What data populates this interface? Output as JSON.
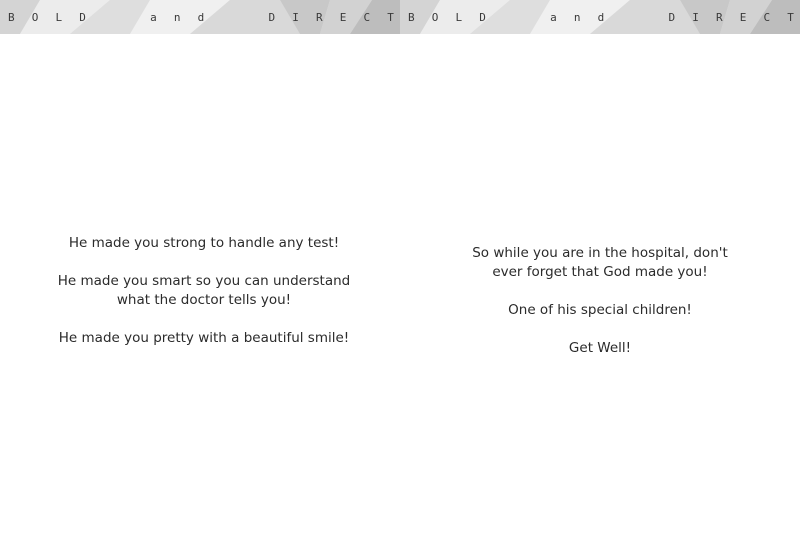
{
  "banner": {
    "letters": [
      "B",
      "O",
      "L",
      "D",
      "a",
      "n",
      "d",
      "D",
      "I",
      "R",
      "E",
      "C",
      "T"
    ],
    "fill": "#e6e6e6"
  },
  "left_page": {
    "paragraphs": [
      "He made you strong to handle any test!",
      "He made you smart so you can understand\nwhat the doctor tells you!",
      "He made you pretty with a beautiful smile!"
    ]
  },
  "right_page": {
    "paragraphs": [
      "So while you are in the hospital, don't\never forget that God made you!",
      "One of his special children!",
      "Get Well!"
    ]
  }
}
